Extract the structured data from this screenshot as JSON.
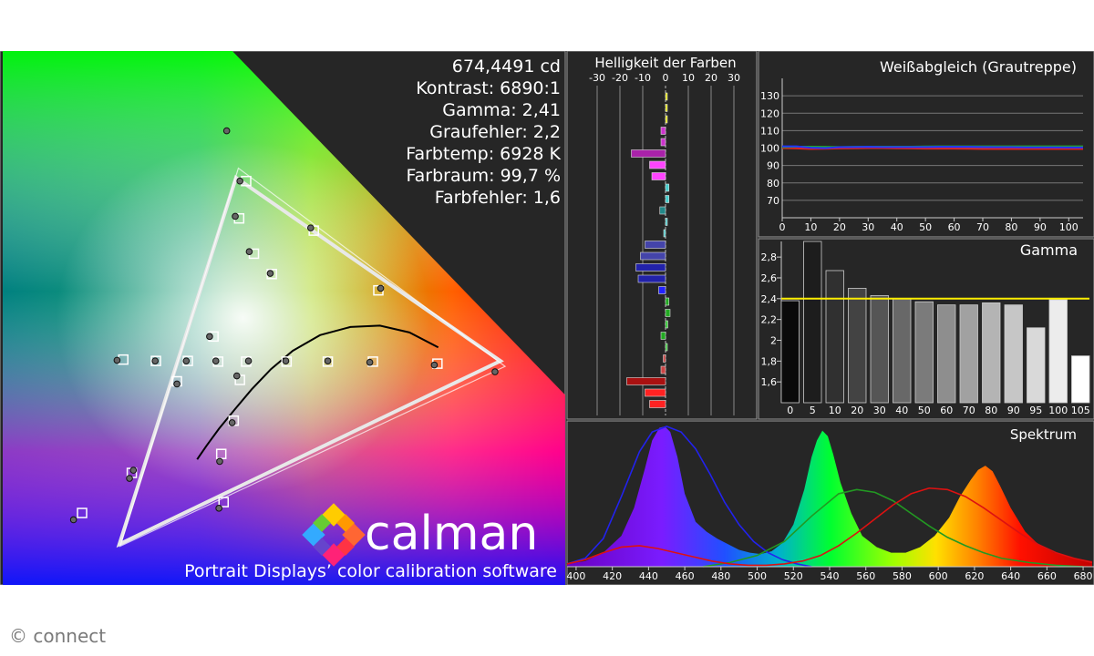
{
  "colors": {
    "background": "#1a1a1a",
    "panel": "#262626",
    "panel_border": "#9a9a9a",
    "text": "#ffffff",
    "gamut_outline": "#e8e8e8",
    "gamma_target": "#ffee00",
    "grid": "#888888"
  },
  "stats": {
    "luminance": "674,4491 cd",
    "contrast": "Kontrast: 6890:1",
    "gamma": "Gamma: 2,41",
    "gray_error": "Graufehler: 2,2",
    "color_temp": "Farbtemp: 6928 K",
    "color_space": "Farbraum: 99,7 %",
    "color_error": "Farbfehler: 1,6"
  },
  "branding": {
    "logo_text": "calman",
    "tagline": "Portrait Displays’ color calibration software"
  },
  "copyright": "© connect",
  "chart_data": [
    {
      "type": "scatter",
      "id": "cie",
      "title": "",
      "note": "CIE 1931 xy chromaticity diagram",
      "target_triangle": [
        [
          0.64,
          0.33
        ],
        [
          0.3,
          0.6
        ],
        [
          0.15,
          0.06
        ]
      ],
      "measured_triangle": [
        [
          0.646,
          0.322
        ],
        [
          0.303,
          0.614
        ],
        [
          0.151,
          0.057
        ]
      ],
      "targets": [
        [
          0.313,
          0.329
        ],
        [
          0.559,
          0.326
        ],
        [
          0.476,
          0.329
        ],
        [
          0.418,
          0.329
        ],
        [
          0.365,
          0.329
        ],
        [
          0.155,
          0.332
        ],
        [
          0.197,
          0.33
        ],
        [
          0.238,
          0.33
        ],
        [
          0.277,
          0.329
        ],
        [
          0.323,
          0.488
        ],
        [
          0.346,
          0.458
        ],
        [
          0.4,
          0.522
        ],
        [
          0.483,
          0.434
        ],
        [
          0.304,
          0.54
        ],
        [
          0.313,
          0.595
        ],
        [
          0.271,
          0.366
        ],
        [
          0.305,
          0.302
        ],
        [
          0.297,
          0.242
        ],
        [
          0.281,
          0.193
        ],
        [
          0.284,
          0.122
        ],
        [
          0.166,
          0.165
        ],
        [
          0.102,
          0.106
        ],
        [
          0.224,
          0.3
        ]
      ],
      "measurements": [
        [
          0.316,
          0.33
        ],
        [
          0.555,
          0.324
        ],
        [
          0.472,
          0.328
        ],
        [
          0.418,
          0.33
        ],
        [
          0.364,
          0.33
        ],
        [
          0.147,
          0.331
        ],
        [
          0.196,
          0.33
        ],
        [
          0.236,
          0.33
        ],
        [
          0.274,
          0.33
        ],
        [
          0.317,
          0.491
        ],
        [
          0.344,
          0.459
        ],
        [
          0.396,
          0.526
        ],
        [
          0.486,
          0.437
        ],
        [
          0.299,
          0.543
        ],
        [
          0.305,
          0.595
        ],
        [
          0.266,
          0.366
        ],
        [
          0.301,
          0.308
        ],
        [
          0.295,
          0.239
        ],
        [
          0.279,
          0.182
        ],
        [
          0.278,
          0.113
        ],
        [
          0.163,
          0.157
        ],
        [
          0.091,
          0.096
        ],
        [
          0.224,
          0.296
        ],
        [
          0.288,
          0.669
        ],
        [
          0.633,
          0.314
        ],
        [
          0.168,
          0.169
        ]
      ],
      "planckian_locus": [
        [
          0.56,
          0.35
        ],
        [
          0.523,
          0.372
        ],
        [
          0.485,
          0.382
        ],
        [
          0.447,
          0.38
        ],
        [
          0.408,
          0.368
        ],
        [
          0.373,
          0.345
        ],
        [
          0.345,
          0.318
        ],
        [
          0.32,
          0.288
        ],
        [
          0.298,
          0.258
        ],
        [
          0.278,
          0.23
        ],
        [
          0.262,
          0.205
        ],
        [
          0.25,
          0.185
        ]
      ],
      "axis_ranges": {
        "x": [
          0.0,
          0.74
        ],
        "y": [
          0.0,
          0.84
        ]
      }
    },
    {
      "type": "bar",
      "id": "brightness",
      "title": "Helligkeit der Farben",
      "xlim": [
        -35,
        35
      ],
      "ticks": [
        -30,
        -20,
        -10,
        0,
        10,
        20,
        30
      ],
      "tick_labels": [
        "-30",
        "-20",
        "-10",
        "0",
        "10",
        "20",
        "30"
      ],
      "bars": [
        {
          "value": 0.5,
          "color": "#e8e800"
        },
        {
          "value": 0.3,
          "color": "#e8e800"
        },
        {
          "value": 0.2,
          "color": "#e8e800"
        },
        {
          "value": -2,
          "color": "#cc33cc"
        },
        {
          "value": -2,
          "color": "#cc33cc"
        },
        {
          "value": -15,
          "color": "#aa22aa"
        },
        {
          "value": -7,
          "color": "#ff44ff"
        },
        {
          "value": -6,
          "color": "#ff44ff"
        },
        {
          "value": 1.5,
          "color": "#44cccc"
        },
        {
          "value": 1.5,
          "color": "#44cccc"
        },
        {
          "value": -2.5,
          "color": "#228888"
        },
        {
          "value": 0.5,
          "color": "#44cccc"
        },
        {
          "value": -0.5,
          "color": "#44cccc"
        },
        {
          "value": -9,
          "color": "#4444aa"
        },
        {
          "value": -11,
          "color": "#4444aa"
        },
        {
          "value": -13,
          "color": "#2222aa"
        },
        {
          "value": -12,
          "color": "#2222aa"
        },
        {
          "value": -3,
          "color": "#2222ff"
        },
        {
          "value": 1.5,
          "color": "#22aa22"
        },
        {
          "value": 2,
          "color": "#22aa22"
        },
        {
          "value": 1,
          "color": "#33cc33"
        },
        {
          "value": -2,
          "color": "#22aa22"
        },
        {
          "value": 0.5,
          "color": "#33cc33"
        },
        {
          "value": -1,
          "color": "#cc4444"
        },
        {
          "value": -2,
          "color": "#cc4444"
        },
        {
          "value": -17,
          "color": "#aa1111"
        },
        {
          "value": -9,
          "color": "#ff2222"
        },
        {
          "value": -7,
          "color": "#ff2222"
        }
      ]
    },
    {
      "type": "line",
      "id": "white_balance",
      "title": "Weißabgleich (Grautreppe)",
      "xlim": [
        0,
        105
      ],
      "ylim": [
        60,
        140
      ],
      "x_ticks": [
        0,
        10,
        20,
        30,
        40,
        50,
        60,
        70,
        80,
        90,
        100
      ],
      "x_tick_labels": [
        "0",
        "10",
        "20",
        "30",
        "40",
        "50",
        "60",
        "70",
        "80",
        "90",
        "100"
      ],
      "y_ticks": [
        70,
        80,
        90,
        100,
        110,
        120,
        130
      ],
      "y_tick_labels": [
        "70",
        "80",
        "90",
        "100",
        "110",
        "120",
        "130"
      ],
      "x": [
        0,
        5,
        10,
        15,
        20,
        25,
        30,
        35,
        40,
        45,
        50,
        55,
        60,
        65,
        70,
        75,
        80,
        85,
        90,
        95,
        100,
        105
      ],
      "series": [
        {
          "color": "#dd2222",
          "values": [
            100,
            99.8,
            99.5,
            99.6,
            99.8,
            99.9,
            100,
            100,
            99.9,
            99.8,
            99.7,
            99.7,
            99.7,
            99.6,
            99.5,
            99.5,
            99.5,
            99.5,
            99.5,
            99.5,
            99.5,
            99.5
          ]
        },
        {
          "color": "#22aa22",
          "values": [
            100.5,
            100.8,
            100.8,
            100.7,
            100.6,
            100.7,
            100.8,
            100.8,
            100.8,
            100.8,
            100.9,
            101,
            101,
            101,
            101,
            101,
            101,
            101,
            101,
            101,
            101,
            101
          ]
        },
        {
          "color": "#2233ff",
          "values": [
            101,
            101,
            100.2,
            100,
            100.5,
            100.6,
            100.7,
            100.6,
            100.6,
            100.6,
            100.6,
            100.7,
            100.7,
            100.7,
            100.6,
            100.5,
            100.5,
            100.4,
            100.4,
            100.4,
            100.3,
            100.3
          ]
        }
      ]
    },
    {
      "type": "bar",
      "id": "gamma",
      "title": "Gamma",
      "ylim": [
        1.4,
        2.95
      ],
      "y_ticks": [
        1.6,
        1.8,
        2.0,
        2.2,
        2.4,
        2.6,
        2.8
      ],
      "y_tick_labels": [
        "1,6",
        "1,8",
        "2",
        "2,2",
        "2,4",
        "2,6",
        "2,8"
      ],
      "categories": [
        "0",
        "5",
        "10",
        "20",
        "30",
        "40",
        "50",
        "60",
        "70",
        "80",
        "90",
        "95",
        "100",
        "105"
      ],
      "values": [
        2.38,
        2.95,
        2.67,
        2.5,
        2.43,
        2.4,
        2.37,
        2.34,
        2.34,
        2.36,
        2.34,
        2.12,
        2.39,
        1.85
      ],
      "target": 2.4
    },
    {
      "type": "area",
      "id": "spectrum",
      "title": "Spektrum",
      "xlim": [
        395,
        685
      ],
      "x_ticks": [
        400,
        420,
        440,
        460,
        480,
        500,
        520,
        540,
        560,
        580,
        600,
        620,
        640,
        660,
        680
      ],
      "x_tick_labels": [
        "400",
        "420",
        "440",
        "460",
        "480",
        "500",
        "520",
        "540",
        "560",
        "580",
        "600",
        "620",
        "640",
        "660",
        "680"
      ],
      "x": [
        395,
        405,
        415,
        425,
        432,
        438,
        442,
        446,
        449,
        452,
        456,
        460,
        466,
        472,
        478,
        484,
        490,
        496,
        502,
        508,
        514,
        520,
        526,
        530,
        533,
        536,
        539,
        542,
        546,
        552,
        558,
        566,
        574,
        582,
        590,
        598,
        606,
        612,
        618,
        622,
        626,
        630,
        634,
        640,
        648,
        656,
        664,
        672,
        685
      ],
      "values": [
        0.02,
        0.04,
        0.1,
        0.22,
        0.42,
        0.7,
        0.9,
        0.99,
        1.0,
        0.96,
        0.78,
        0.52,
        0.32,
        0.25,
        0.2,
        0.16,
        0.12,
        0.1,
        0.09,
        0.11,
        0.17,
        0.3,
        0.55,
        0.78,
        0.9,
        0.97,
        0.93,
        0.8,
        0.6,
        0.38,
        0.22,
        0.14,
        0.1,
        0.1,
        0.14,
        0.22,
        0.35,
        0.5,
        0.62,
        0.69,
        0.72,
        0.68,
        0.58,
        0.42,
        0.25,
        0.15,
        0.1,
        0.07,
        0.04
      ],
      "series": [
        {
          "color": "#2222ee",
          "x": [
            395,
            405,
            415,
            425,
            435,
            442,
            450,
            458,
            466,
            474,
            482,
            490,
            498,
            506,
            514,
            522,
            530
          ],
          "values": [
            0.02,
            0.06,
            0.2,
            0.5,
            0.82,
            0.96,
            1.0,
            0.96,
            0.84,
            0.66,
            0.46,
            0.3,
            0.18,
            0.1,
            0.05,
            0.02,
            0.0
          ]
        },
        {
          "color": "#229922",
          "x": [
            470,
            485,
            500,
            515,
            530,
            545,
            555,
            565,
            575,
            585,
            595,
            605,
            615,
            625,
            635,
            650,
            665,
            680
          ],
          "values": [
            0.0,
            0.03,
            0.08,
            0.18,
            0.36,
            0.52,
            0.55,
            0.53,
            0.47,
            0.38,
            0.29,
            0.21,
            0.15,
            0.1,
            0.06,
            0.03,
            0.01,
            0.0
          ]
        },
        {
          "color": "#dd1111",
          "x": [
            395,
            405,
            415,
            425,
            435,
            445,
            455,
            465,
            475,
            485,
            495,
            505,
            515,
            525,
            535,
            545,
            555,
            565,
            575,
            585,
            595,
            605,
            615,
            625,
            635,
            645,
            655,
            665,
            675,
            685
          ],
          "values": [
            0.02,
            0.05,
            0.1,
            0.14,
            0.15,
            0.13,
            0.1,
            0.07,
            0.04,
            0.02,
            0.01,
            0.01,
            0.02,
            0.04,
            0.08,
            0.15,
            0.24,
            0.34,
            0.44,
            0.52,
            0.56,
            0.55,
            0.5,
            0.42,
            0.33,
            0.24,
            0.16,
            0.1,
            0.06,
            0.03
          ]
        }
      ]
    }
  ]
}
